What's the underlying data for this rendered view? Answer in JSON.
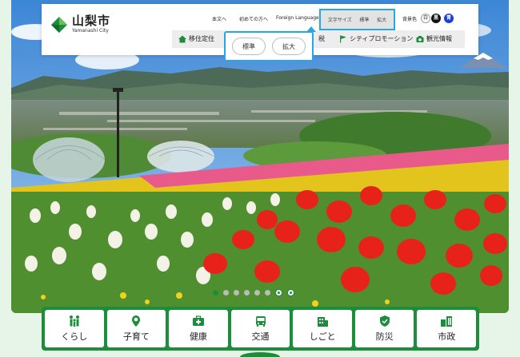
{
  "site": {
    "name_jp": "山梨市",
    "name_en": "Yamanashi City"
  },
  "utility": {
    "skip_to_main": "本文へ",
    "first_visit": "初めての方へ",
    "language": "Foreign Language",
    "font_size_label": "文字サイズ",
    "font_standard": "標準",
    "font_large": "拡大",
    "bg_color_label": "背景色",
    "bg_white": "白",
    "bg_black": "黒",
    "bg_blue": "青"
  },
  "nav": {
    "migrate": "移住定住",
    "tourism_partial": "税",
    "promotion": "シティプロモーション",
    "kanko": "観光情報"
  },
  "popup": {
    "standard": "標準",
    "large": "拡大"
  },
  "slider": {
    "dot_count": 8,
    "active_index": 0
  },
  "categories": [
    {
      "label": "くらし",
      "icon": "family-icon"
    },
    {
      "label": "子育て",
      "icon": "child-icon"
    },
    {
      "label": "健康",
      "icon": "medical-kit-icon"
    },
    {
      "label": "交通",
      "icon": "bus-icon"
    },
    {
      "label": "しごと",
      "icon": "building-icon"
    },
    {
      "label": "防災",
      "icon": "shield-icon"
    },
    {
      "label": "市政",
      "icon": "city-hall-icon"
    }
  ],
  "colors": {
    "brand_green": "#1c8d3b",
    "focus_blue": "#2aa7e3",
    "page_bg": "#e7f4e8"
  }
}
